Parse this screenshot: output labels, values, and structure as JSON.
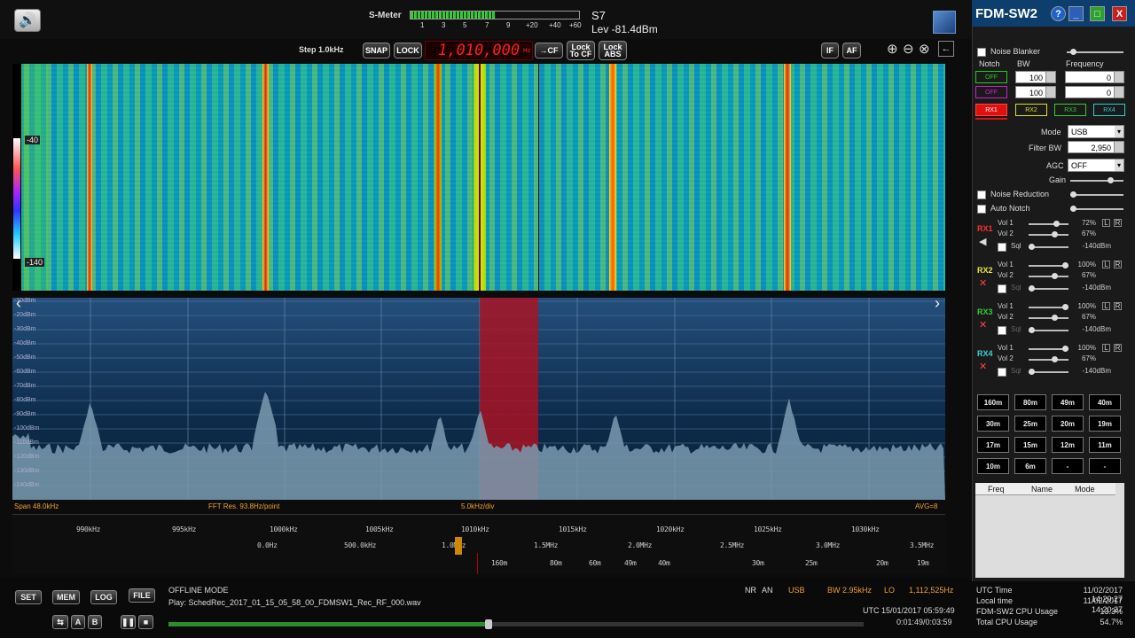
{
  "app": {
    "title": "FDM-SW2",
    "help": "?"
  },
  "smeter": {
    "label": "S-Meter",
    "scale": [
      "1",
      "3",
      "5",
      "7",
      "9",
      "+20",
      "+40",
      "+60"
    ],
    "s_value": "S7",
    "level": "Lev -81.4dBm",
    "fill_fraction": 0.5
  },
  "toolbar": {
    "step": "Step 1.0kHz",
    "snap": "SNAP",
    "lock": "LOCK",
    "frequency": "1,010,000",
    "freq_unit": "Hz",
    "to_cf": "→CF",
    "lock_to_cf": "Lock\nTo CF",
    "lock_abs": "Lock\nABS",
    "if": "IF",
    "af": "AF"
  },
  "waterfall": {
    "top_db": "-40",
    "bottom_db": "-140"
  },
  "spectrum": {
    "db_labels": [
      "-10dBm",
      "-20dBm",
      "-30dBm",
      "-40dBm",
      "-50dBm",
      "-60dBm",
      "-70dBm",
      "-80dBm",
      "-90dBm",
      "-100dBm",
      "-110dBm",
      "-120dBm",
      "-130dBm",
      "-140dBm"
    ],
    "span": "Span 48.0kHz",
    "fft": "FFT Res. 93.8Hz/point",
    "div": "5.0kHz/div",
    "avg": "AVG=8"
  },
  "scale_khz": [
    "990kHz",
    "995kHz",
    "1000kHz",
    "1005kHz",
    "1010kHz",
    "1015kHz",
    "1020kHz",
    "1025kHz",
    "1030kHz"
  ],
  "scale_mhz": [
    "0.0Hz",
    "500.0kHz",
    "1.0MHz",
    "1.5MHz",
    "2.0MHz",
    "2.5MHz",
    "3.0MHz",
    "3.5MHz"
  ],
  "scale_m": [
    "160m",
    "80m",
    "60m",
    "49m",
    "40m",
    "30m",
    "25m",
    "20m",
    "19m"
  ],
  "bottom": {
    "set": "SET",
    "mem": "MEM",
    "log": "LOG",
    "file": "FILE",
    "a": "A",
    "b": "B",
    "mode_text": "OFFLINE MODE",
    "play": "Play: SchedRec_2017_01_15_05_58_00_FDMSW1_Rec_RF_000.wav",
    "nr": "NR",
    "an": "AN",
    "mode": "USB",
    "bw": "BW 2.95kHz",
    "lo": "LO",
    "lo_freq": "1,112,525Hz",
    "utc": "UTC 15/01/2017 05:59:49",
    "time": "0:01:49/0:03:59",
    "progress": 0.46
  },
  "right": {
    "noise_blanker": "Noise Blanker",
    "notch": "Notch",
    "bw": "BW",
    "frequency": "Frequency",
    "notch_rows": [
      {
        "state": "OFF",
        "bw": "100",
        "freq": "0"
      },
      {
        "state": "OFF",
        "bw": "100",
        "freq": "0"
      }
    ],
    "rx_tabs": [
      "RX1",
      "RX2",
      "RX3",
      "RX4"
    ],
    "mode_label": "Mode",
    "mode": "USB",
    "filter_label": "Filter BW",
    "filter": "2,950",
    "agc_label": "AGC",
    "agc": "OFF",
    "gain": "Gain",
    "noise_reduction": "Noise Reduction",
    "auto_notch": "Auto Notch",
    "rx": [
      {
        "name": "RX1",
        "vol1": "72%",
        "vol2": "67%",
        "sql": "-140dBm",
        "color": "#ff3030"
      },
      {
        "name": "RX2",
        "vol1": "100%",
        "vol2": "67%",
        "sql": "-140dBm",
        "color": "#e6e640"
      },
      {
        "name": "RX3",
        "vol1": "100%",
        "vol2": "67%",
        "sql": "-140dBm",
        "color": "#30d030"
      },
      {
        "name": "RX4",
        "vol1": "100%",
        "vol2": "67%",
        "sql": "-140dBm",
        "color": "#40d0d0"
      }
    ],
    "vol1": "Vol 1",
    "vol2": "Vol 2",
    "sql": "Sql",
    "l": "L",
    "r": "R",
    "bands": [
      "160m",
      "80m",
      "49m",
      "40m",
      "30m",
      "25m",
      "20m",
      "19m",
      "17m",
      "15m",
      "12m",
      "11m",
      "10m",
      "6m",
      "",
      ""
    ],
    "mem_cols": [
      "Freq",
      "Name",
      "Mode"
    ],
    "status": [
      {
        "k": "UTC Time",
        "v": "11/02/2017 14:20:27"
      },
      {
        "k": "Local time",
        "v": "11/02/2017 14:20:27"
      },
      {
        "k": "FDM-SW2 CPU Usage",
        "v": "13.3%"
      },
      {
        "k": "Total CPU Usage",
        "v": "54.7%"
      }
    ]
  },
  "colors": {
    "accent": "#ff2020",
    "spectrum_bg": "#1b4670",
    "filter_band": "#b01020"
  }
}
